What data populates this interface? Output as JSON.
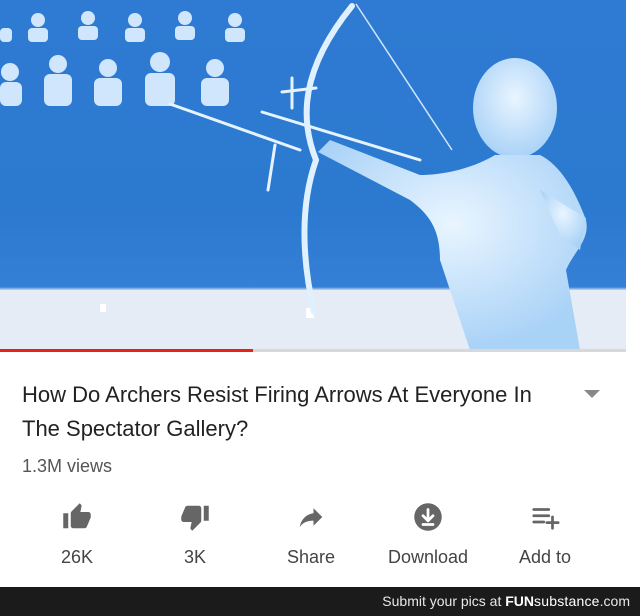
{
  "video": {
    "progress_fraction": 0.404,
    "title": "How Do Archers Resist Firing Arrows At Everyone In The Spectator Gallery?",
    "views": "1.3M views"
  },
  "actions": [
    {
      "icon": "thumbs-up-icon",
      "label": "26K"
    },
    {
      "icon": "thumbs-down-icon",
      "label": "3K"
    },
    {
      "icon": "share-icon",
      "label": "Share"
    },
    {
      "icon": "download-icon",
      "label": "Download"
    },
    {
      "icon": "add-to-playlist-icon",
      "label": "Add to"
    }
  ],
  "footer": {
    "prefix": "Submit your pics at",
    "brand": "FUN",
    "brand_rest": "substance",
    "suffix": ".com"
  },
  "colors": {
    "accent": "#e62117",
    "video_blue": "#2f7bd3",
    "icon_gray": "#666666"
  }
}
